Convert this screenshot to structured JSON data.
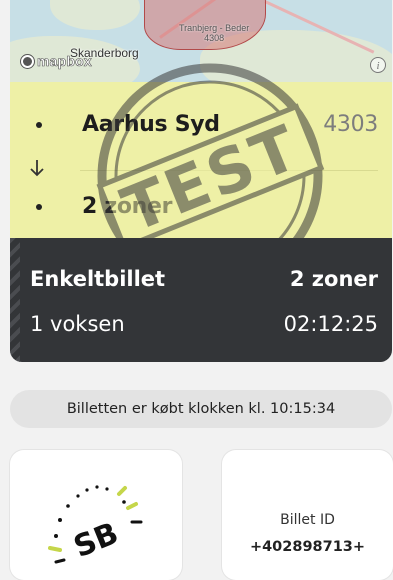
{
  "map": {
    "place_label": "Skanderborg",
    "zone_label_line1": "Tranbjerg - Beder",
    "zone_label_line2": "4308",
    "attribution": "mapbox",
    "info_icon": "info-icon"
  },
  "route": {
    "from_name": "Aarhus Syd",
    "from_zone": "4303",
    "to_name": "2 zoner",
    "arrow_icon": "arrow-down-icon",
    "stamp_text": "TEST"
  },
  "fare": {
    "ticket_type": "Enkeltbillet",
    "zones": "2 zoner",
    "passengers": "1 voksen",
    "countdown": "02:12:25"
  },
  "purchase_note": "Billetten er købt klokken kl. 10:15:34",
  "cards": {
    "logo_text": "SB",
    "billet_id_label": "Billet ID",
    "billet_id_value": "+402898713+"
  },
  "colors": {
    "route_background": "#eef0a6",
    "fare_background": "#333538",
    "accent_green": "#c5d64a"
  }
}
